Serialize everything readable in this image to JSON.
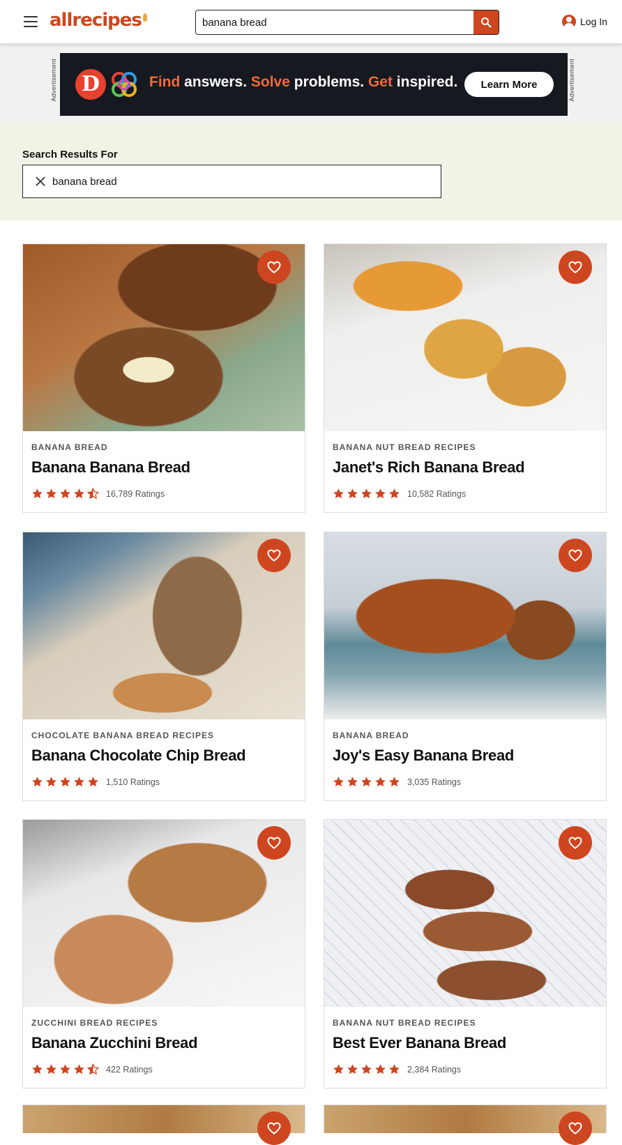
{
  "header": {
    "logo": "allrecipes",
    "search_value": "banana bread",
    "login_label": "Log In"
  },
  "ad": {
    "side_label": "Advertisement",
    "word1": "Find",
    "text1": " answers. ",
    "word2": "Solve",
    "text2": " problems. ",
    "word3": "Get",
    "text3": " inspired.",
    "button_label": "Learn More"
  },
  "search_results": {
    "label": "Search Results For",
    "value": "banana bread"
  },
  "cards": [
    {
      "category": "BANANA BREAD",
      "title": "Banana Banana Bread",
      "rating": 4.5,
      "ratings_label": "16,789 Ratings"
    },
    {
      "category": "BANANA NUT BREAD RECIPES",
      "title": "Janet's Rich Banana Bread",
      "rating": 5,
      "ratings_label": "10,582 Ratings"
    },
    {
      "category": "CHOCOLATE BANANA BREAD RECIPES",
      "title": "Banana Chocolate Chip Bread",
      "rating": 5,
      "ratings_label": "1,510 Ratings"
    },
    {
      "category": "BANANA BREAD",
      "title": "Joy's Easy Banana Bread",
      "rating": 5,
      "ratings_label": "3,035 Ratings"
    },
    {
      "category": "ZUCCHINI BREAD RECIPES",
      "title": "Banana Zucchini Bread",
      "rating": 4.5,
      "ratings_label": "422 Ratings"
    },
    {
      "category": "BANANA NUT BREAD RECIPES",
      "title": "Best Ever Banana Bread",
      "rating": 5,
      "ratings_label": "2,384 Ratings"
    }
  ],
  "colors": {
    "brand": "#ce4620",
    "results_band": "#f2f3e7",
    "ad_bg": "#161a20"
  }
}
